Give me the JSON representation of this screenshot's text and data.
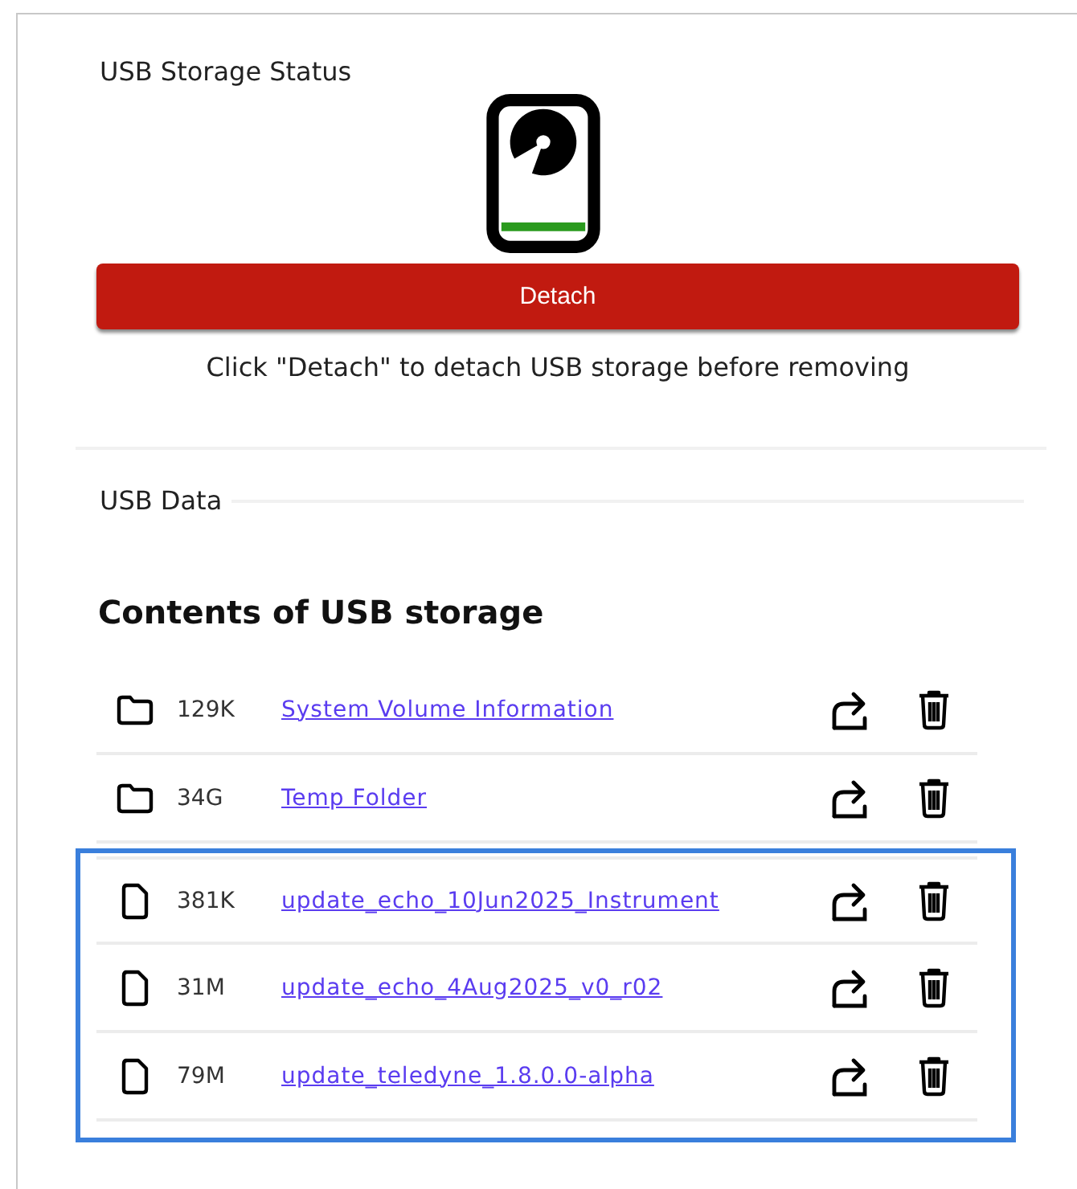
{
  "status_section": {
    "title": "USB Storage Status",
    "drive_connected": true,
    "detach_button": "Detach",
    "hint": "Click \"Detach\" to detach USB storage before removing"
  },
  "data_section": {
    "title": "USB Data",
    "heading": "Contents of USB storage",
    "entries": [
      {
        "kind": "folder",
        "size": "129K",
        "name": "System Volume Information",
        "highlighted": false
      },
      {
        "kind": "folder",
        "size": "34G",
        "name": "Temp Folder",
        "highlighted": false
      },
      {
        "kind": "file",
        "size": "381K",
        "name": "update_echo_10Jun2025_Instrument",
        "highlighted": true
      },
      {
        "kind": "file",
        "size": "31M",
        "name": "update_echo_4Aug2025_v0_r02",
        "highlighted": true
      },
      {
        "kind": "file",
        "size": "79M",
        "name": "update_teledyne_1.8.0.0-alpha",
        "highlighted": true
      }
    ]
  }
}
